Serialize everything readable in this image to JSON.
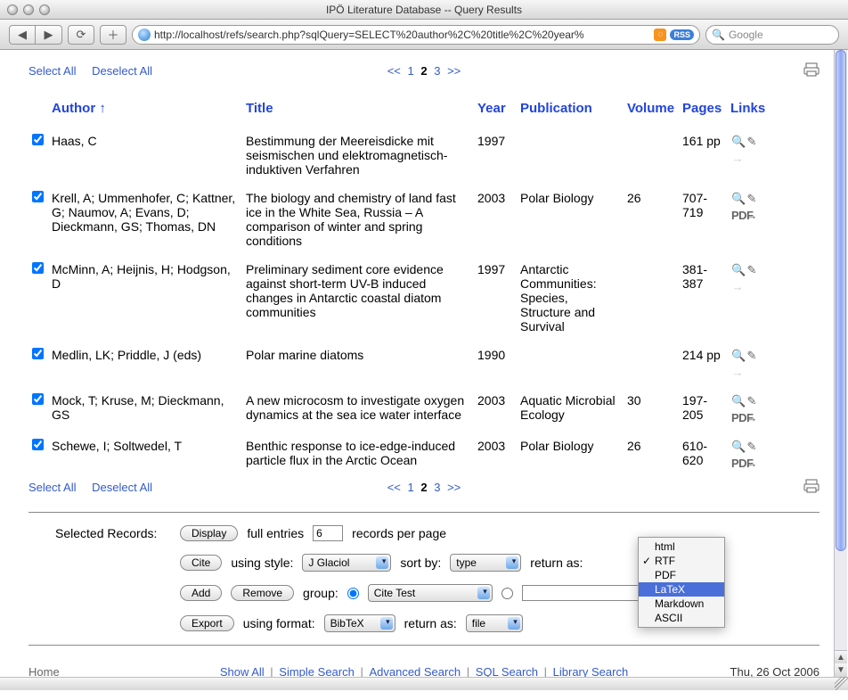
{
  "window_title": "IPÖ Literature Database -- Query Results",
  "url": "http://localhost/refs/search.php?sqlQuery=SELECT%20author%2C%20title%2C%20year%",
  "search_placeholder": "Google",
  "nav": {
    "select_all": "Select All",
    "deselect_all": "Deselect All",
    "prev": "<<",
    "pages": [
      "1",
      "2",
      "3"
    ],
    "current_page": "2",
    "next": ">>"
  },
  "columns": {
    "author": "Author",
    "title": "Title",
    "year": "Year",
    "publication": "Publication",
    "volume": "Volume",
    "pages": "Pages",
    "links": "Links"
  },
  "sort_indicator": "↑",
  "rows": [
    {
      "author": "Haas, C",
      "title": "Bestimmung der Meereisdicke mit seismischen und elektromagnetisch-induktiven Verfahren",
      "year": "1997",
      "publication": "",
      "volume": "",
      "pages": "161 pp",
      "has_pdf": false
    },
    {
      "author": "Krell, A; Ummenhofer, C; Kattner, G; Naumov, A; Evans, D; Dieckmann, GS; Thomas, DN",
      "title": "The biology and chemistry of land fast ice in the White Sea, Russia – A comparison of winter and spring conditions",
      "year": "2003",
      "publication": "Polar Biology",
      "volume": "26",
      "pages": "707-719",
      "has_pdf": true
    },
    {
      "author": "McMinn, A; Heijnis, H; Hodgson, D",
      "title": "Preliminary sediment core evidence against short-term UV-B induced changes in Antarctic coastal diatom communities",
      "year": "1997",
      "publication": "Antarctic Communities: Species, Structure and Survival",
      "volume": "",
      "pages": "381-387",
      "has_pdf": false
    },
    {
      "author": "Medlin, LK; Priddle, J (eds)",
      "title": "Polar marine diatoms",
      "year": "1990",
      "publication": "",
      "volume": "",
      "pages": "214 pp",
      "has_pdf": false
    },
    {
      "author": "Mock, T; Kruse, M; Dieckmann, GS",
      "title": "A new microcosm to investigate oxygen dynamics at the sea ice water interface",
      "year": "2003",
      "publication": "Aquatic Microbial Ecology",
      "volume": "30",
      "pages": "197-205",
      "has_pdf": true
    },
    {
      "author": "Schewe, I; Soltwedel, T",
      "title": "Benthic response to ice-edge-induced particle flux in the Arctic Ocean",
      "year": "2003",
      "publication": "Polar Biology",
      "volume": "26",
      "pages": "610-620",
      "has_pdf": true
    }
  ],
  "controls": {
    "selected_records": "Selected Records:",
    "display": "Display",
    "full_entries": "full entries",
    "records_per_page_value": "6",
    "records_per_page": "records per page",
    "cite": "Cite",
    "using_style": "using style:",
    "style_value": "J Glaciol",
    "sort_by": "sort by:",
    "sort_value": "type",
    "return_as": "return as:",
    "add": "Add",
    "remove": "Remove",
    "group": "group:",
    "group_value": "Cite Test",
    "export": "Export",
    "using_format": "using format:",
    "format_value": "BibTeX",
    "return_as2": "return as:",
    "return_value": "file"
  },
  "menu": {
    "items": [
      "html",
      "RTF",
      "PDF",
      "LaTeX",
      "Markdown",
      "ASCII"
    ],
    "checked": "RTF",
    "highlighted": "LaTeX"
  },
  "footer": {
    "home": "Home",
    "links": [
      "Show All",
      "Simple Search",
      "Advanced Search",
      "SQL Search",
      "Library Search"
    ],
    "date": "Thu, 26 Oct 2006"
  }
}
